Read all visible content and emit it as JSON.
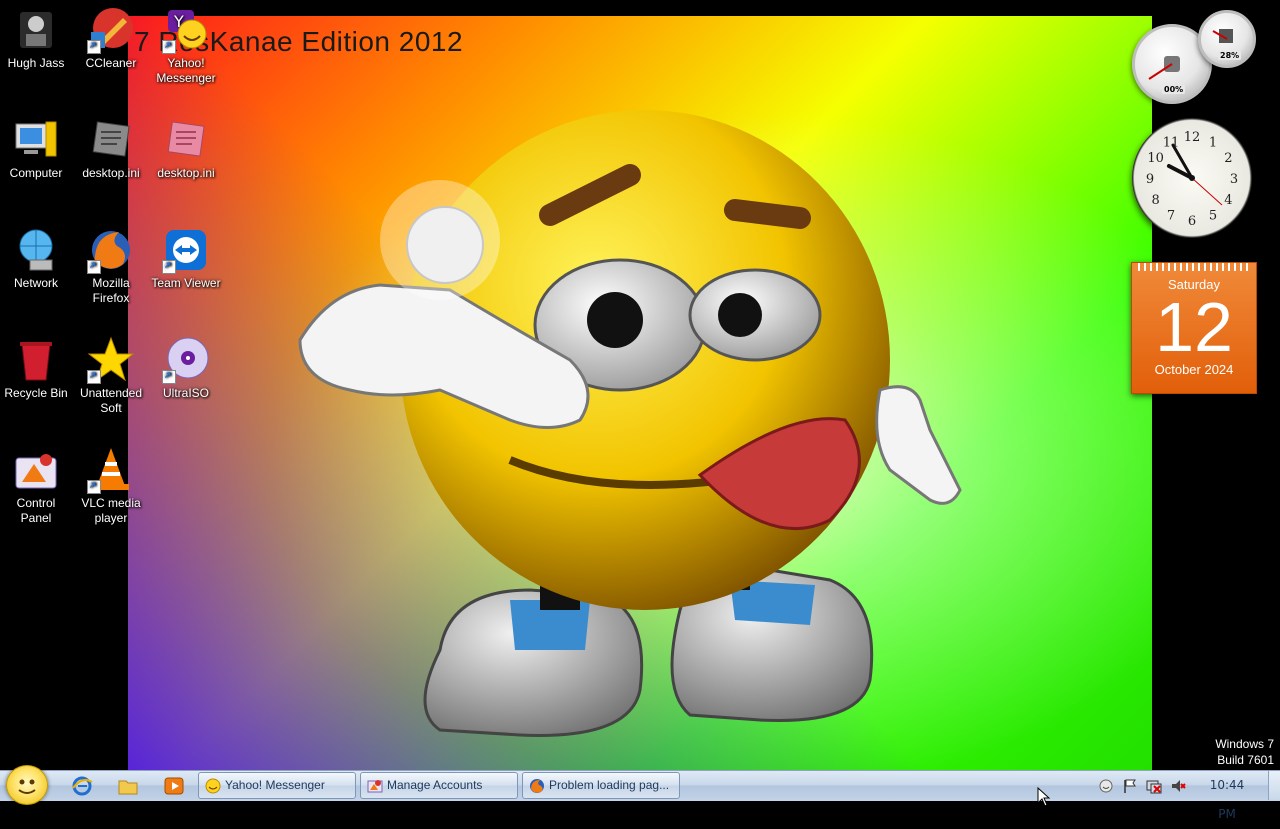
{
  "wallpaper": {
    "title": "7 RosKanae Edition 2012"
  },
  "desktop_icons": [
    {
      "label": "Hugh Jass"
    },
    {
      "label": "CCleaner"
    },
    {
      "label": "Yahoo! Messenger"
    },
    {
      "label": "Computer"
    },
    {
      "label": "desktop.ini"
    },
    {
      "label": "desktop.ini"
    },
    {
      "label": "Network"
    },
    {
      "label": "Mozilla Firefox"
    },
    {
      "label": "Team Viewer"
    },
    {
      "label": "Recycle Bin"
    },
    {
      "label": "Unattended Soft"
    },
    {
      "label": "UltraISO"
    },
    {
      "label": "Control Panel"
    },
    {
      "label": "VLC media player"
    }
  ],
  "gadgets": {
    "cpu_meter": {
      "cpu": "00%",
      "memory": "28%"
    },
    "clock": {
      "hour": 9,
      "minute": 55,
      "second": 22
    },
    "calendar": {
      "day_of_week": "Saturday",
      "day": "12",
      "month_year": "October 2024"
    }
  },
  "watermark": {
    "line1": "Windows 7",
    "line2": "Build 7601"
  },
  "taskbar": {
    "quick_launch": [
      "internet-explorer-icon",
      "folder-icon",
      "media-player-icon"
    ],
    "tasks": [
      {
        "label": "Yahoo! Messenger",
        "icon": "yahoo-messenger-icon"
      },
      {
        "label": "Manage Accounts",
        "icon": "control-panel-icon"
      },
      {
        "label": "Problem loading pag...",
        "icon": "firefox-icon"
      }
    ],
    "tray": [
      "yahoo-tray-icon",
      "action-center-flag-icon",
      "network-icon",
      "volume-muted-icon"
    ],
    "time": "10:44 PM"
  },
  "colors": {
    "calendar": "#e8701a",
    "taskbar": "#c9d8ea"
  }
}
